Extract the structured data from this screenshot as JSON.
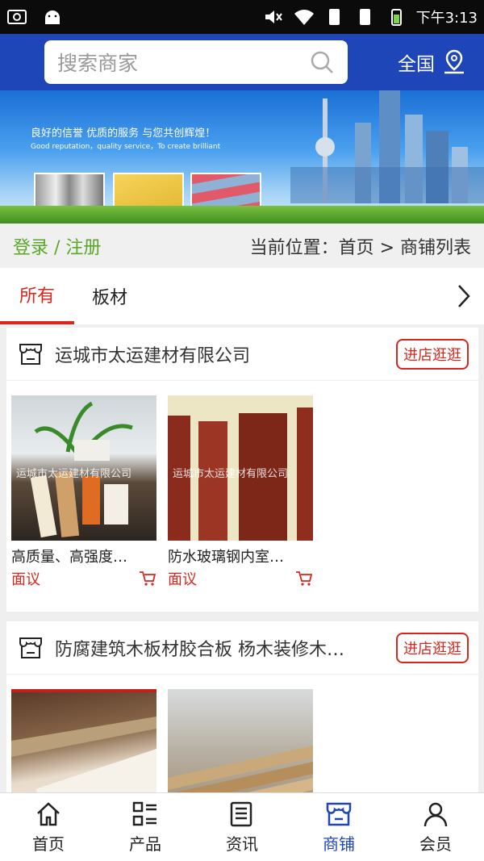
{
  "status_bar": {
    "icons": [
      "screenshot-icon",
      "android-icon",
      "mute-icon",
      "wifi-icon",
      "sim1-icon",
      "sim2-icon",
      "battery-icon"
    ],
    "time": "下午3:13"
  },
  "header": {
    "search_placeholder": "搜索商家",
    "region": "全国",
    "brand_color": "#1f46b8"
  },
  "banner": {
    "slogan_cn": "良好的信誉    优质的服务    与您共创辉煌！",
    "slogan_en": "Good reputation，quality service，To create brilliant"
  },
  "breadcrumb": {
    "login_register": "登录 / 注册",
    "location": "当前位置：首页 > 商铺列表"
  },
  "tabs": {
    "items": [
      {
        "label": "所有",
        "active": true
      },
      {
        "label": "板材",
        "active": false
      }
    ]
  },
  "shops": [
    {
      "name": "运城市太运建材有限公司",
      "enter_label": "进店逛逛",
      "products": [
        {
          "title": "高质量、高强度…",
          "price": "面议",
          "watermark": "运城市太运建材有限公司"
        },
        {
          "title": "防水玻璃钢内室…",
          "price": "面议",
          "watermark": "运城市太运建材有限公司"
        }
      ]
    },
    {
      "name": "防腐建筑木板材胶合板 杨木装修木…",
      "enter_label": "进店逛逛",
      "products": [
        {
          "title": "",
          "price": ""
        },
        {
          "title": "",
          "price": ""
        }
      ]
    }
  ],
  "bottom_nav": [
    {
      "label": "首页",
      "icon": "home-icon",
      "active": false
    },
    {
      "label": "产品",
      "icon": "list-icon",
      "active": false
    },
    {
      "label": "资讯",
      "icon": "news-icon",
      "active": false
    },
    {
      "label": "商铺",
      "icon": "shop-icon",
      "active": true
    },
    {
      "label": "会员",
      "icon": "user-icon",
      "active": false
    }
  ],
  "colors": {
    "accent_red": "#d9261c",
    "login_green": "#5aa82a",
    "active_blue": "#1f46b8"
  }
}
